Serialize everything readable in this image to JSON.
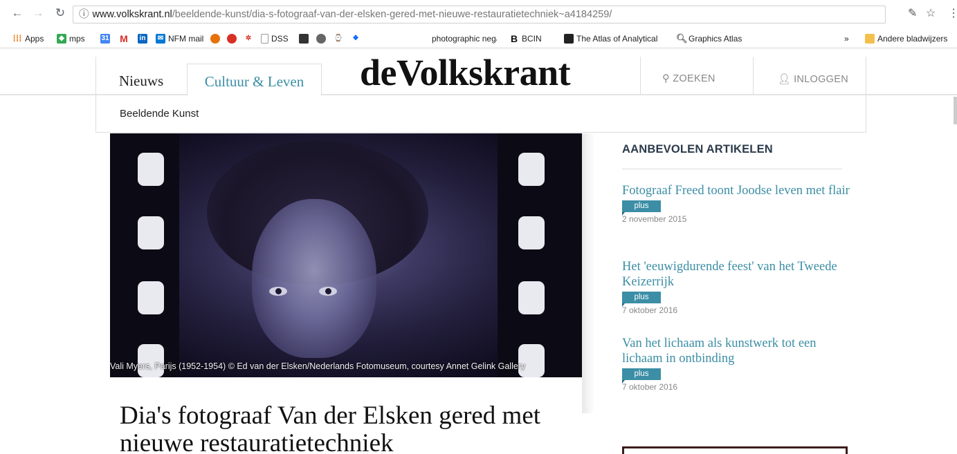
{
  "browser": {
    "url_domain": "www.volkskrant.nl",
    "url_path": "/beeldende-kunst/dia-s-fotograaf-van-der-elsken-gered-met-nieuwe-restauratietechniek~a4184259/",
    "bookmarks": [
      {
        "label": "Apps",
        "icon": "apps-icon",
        "color": "#e8710a"
      },
      {
        "label": "mps",
        "icon": "maps-icon",
        "color": "#34a853"
      },
      {
        "label": "",
        "icon": "calendar-icon",
        "color": "#4285f4"
      },
      {
        "label": "",
        "icon": "gmail-icon",
        "color": "#d93025"
      },
      {
        "label": "",
        "icon": "linkedin-icon",
        "color": "#0a66c2"
      },
      {
        "label": "NFM mail",
        "icon": "mail-icon",
        "color": "#0078d4"
      },
      {
        "label": "",
        "icon": "bookmark-icon-1",
        "color": "#e8710a"
      },
      {
        "label": "",
        "icon": "bookmark-icon-2",
        "color": "#d93025"
      },
      {
        "label": "",
        "icon": "bookmark-icon-3",
        "color": "#d93025"
      },
      {
        "label": "DSS",
        "icon": "page-icon",
        "color": "#999999"
      },
      {
        "label": "",
        "icon": "bookmark-icon-4",
        "color": "#333333"
      },
      {
        "label": "",
        "icon": "bookmark-icon-5",
        "color": "#666666"
      },
      {
        "label": "",
        "icon": "bookmark-icon-6",
        "color": "#555555"
      },
      {
        "label": "",
        "icon": "dropbox-icon",
        "color": "#0061ff"
      },
      {
        "label": "photographic negativ",
        "icon": "",
        "color": ""
      },
      {
        "label": "BCIN",
        "icon": "bcin-icon",
        "color": "#111111"
      },
      {
        "label": "The Atlas of Analytical",
        "icon": "atlas-icon",
        "color": "#222222"
      },
      {
        "label": "Graphics Atlas",
        "icon": "search-icon",
        "color": "#666666"
      }
    ],
    "overflow_label": "»",
    "other_bookmarks": "Andere bladwijzers"
  },
  "site": {
    "logo": "deVolkskrant",
    "nav": {
      "news": "Nieuws",
      "active": "Cultuur & Leven",
      "search": "ZOEKEN",
      "login": "INLOGGEN"
    },
    "subnav": "Beeldende Kunst"
  },
  "hero": {
    "caption": "Vali Myers, Parijs (1952-1954) © Ed van der Elsken/Nederlands Fotomuseum, courtesy Annet Gelink Gallery"
  },
  "article": {
    "title": "Dia's fotograaf Van der Elsken gered met nieuwe restauratietechniek"
  },
  "sidebar": {
    "heading": "AANBEVOLEN ARTIKELEN",
    "items": [
      {
        "title": "Fotograaf Freed toont Joodse leven met flair",
        "badge": "plus",
        "date": "2 november 2015"
      },
      {
        "title": "Het 'eeuwigdurende feest' van het Tweede Keizerrijk",
        "badge": "plus",
        "date": "7 oktober 2016"
      },
      {
        "title": "Van het lichaam als kunstwerk tot een lichaam in ontbinding",
        "badge": "plus",
        "date": "7 oktober 2016"
      }
    ]
  },
  "colors": {
    "accent": "#3b8ea5",
    "heading": "#2b3a4a"
  }
}
